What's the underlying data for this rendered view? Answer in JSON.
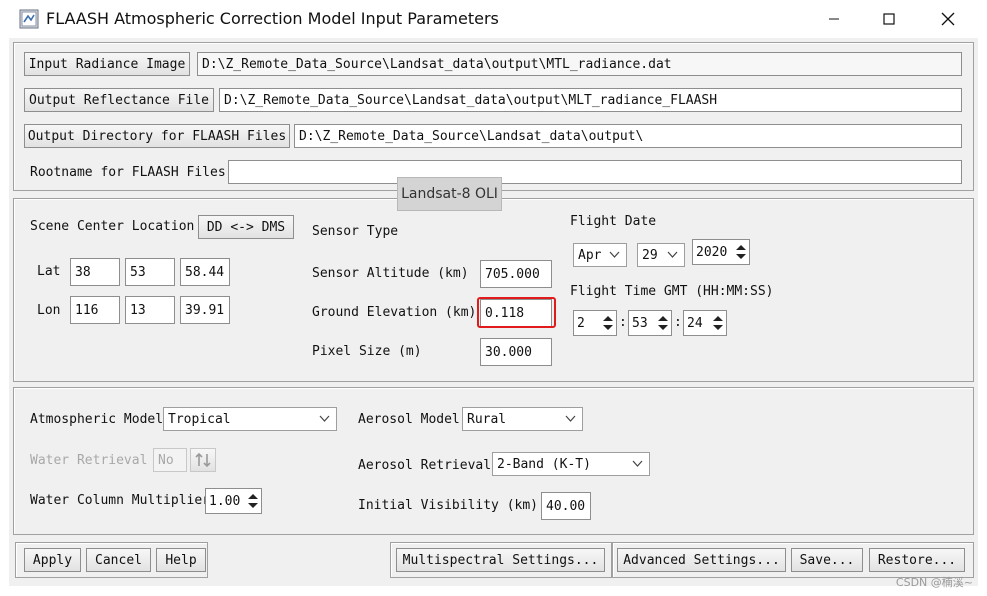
{
  "window": {
    "title": "FLAASH Atmospheric Correction Model Input Parameters",
    "minimize": "minimize-icon",
    "maximize": "maximize-icon",
    "close": "close-icon"
  },
  "files": {
    "input_button": "Input Radiance Image",
    "input_path": "D:\\Z_Remote_Data_Source\\Landsat_data\\output\\MTL_radiance.dat",
    "output_button": "Output Reflectance File",
    "output_path": "D:\\Z_Remote_Data_Source\\Landsat_data\\output\\MLT_radiance_FLAASH",
    "dir_button": "Output Directory for FLAASH Files",
    "dir_path": "D:\\Z_Remote_Data_Source\\Landsat_data\\output\\",
    "rootname_label": "Rootname for FLAASH Files",
    "rootname_value": ""
  },
  "scene": {
    "center_label": "Scene Center Location",
    "dd_dms_button": "DD <-> DMS",
    "lat_label": "Lat",
    "lat": [
      "38",
      "53",
      "58.44"
    ],
    "lon_label": "Lon",
    "lon": [
      "116",
      "13",
      "39.91"
    ],
    "sensor_type_label": "Sensor Type",
    "sensor_type": "Landsat-8 OLI",
    "sensor_altitude_label": "Sensor Altitude (km)",
    "sensor_altitude": "705.000",
    "ground_elevation_label": "Ground Elevation (km)",
    "ground_elevation": "0.118",
    "pixel_size_label": "Pixel Size (m)",
    "pixel_size": "30.000",
    "flight_date_label": "Flight Date",
    "month": "Apr",
    "day": "29",
    "year": "2020",
    "flight_time_label": "Flight Time GMT (HH:MM:SS)",
    "hour": "2",
    "minute": "53",
    "second": "24",
    "sep": ":"
  },
  "atmos": {
    "model_label": "Atmospheric Model",
    "model": "Tropical",
    "water_retrieval_label": "Water Retrieval",
    "water_retrieval": "No",
    "water_column_label": "Water Column Multiplier",
    "water_column": "1.00",
    "aerosol_model_label": "Aerosol Model",
    "aerosol_model": "Rural",
    "aerosol_retrieval_label": "Aerosol Retrieval",
    "aerosol_retrieval": "2-Band (K-T)",
    "visibility_label": "Initial Visibility (km)",
    "visibility": "40.00"
  },
  "footer": {
    "apply": "Apply",
    "cancel": "Cancel",
    "help": "Help",
    "multispectral": "Multispectral Settings...",
    "advanced": "Advanced Settings...",
    "save": "Save...",
    "restore": "Restore..."
  },
  "watermark": "CSDN @楠溪~"
}
